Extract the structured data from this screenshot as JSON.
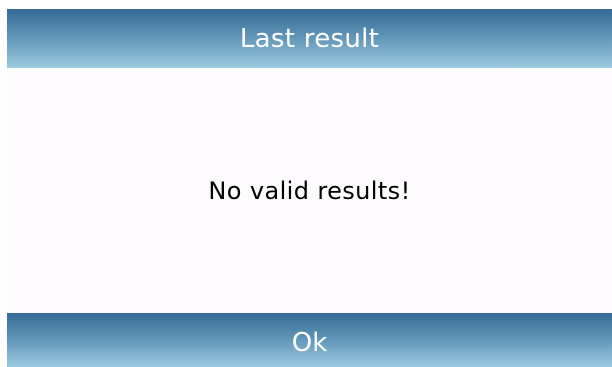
{
  "dialog": {
    "title": "Last result",
    "message": "No valid results!",
    "ok_label": "Ok"
  },
  "colors": {
    "header_dark": "#356b94",
    "header_light": "#9ccbe1",
    "content_bg": "#fdfbfd"
  }
}
